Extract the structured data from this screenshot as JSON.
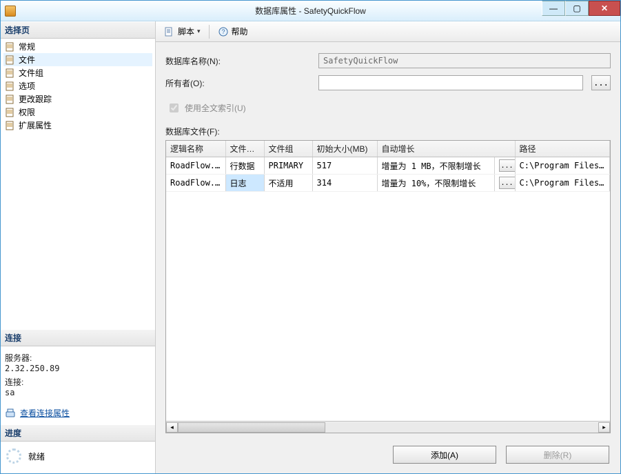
{
  "window": {
    "title": "数据库属性 - SafetyQuickFlow"
  },
  "sidebar": {
    "select_page_header": "选择页",
    "pages": [
      {
        "label": "常规"
      },
      {
        "label": "文件"
      },
      {
        "label": "文件组"
      },
      {
        "label": "选项"
      },
      {
        "label": "更改跟踪"
      },
      {
        "label": "权限"
      },
      {
        "label": "扩展属性"
      }
    ],
    "connection_header": "连接",
    "server_label": "服务器:",
    "server_value": "2.32.250.89",
    "conn_label": "连接:",
    "conn_value": "sa",
    "view_conn_props": "查看连接属性",
    "progress_header": "进度",
    "progress_status": "就绪"
  },
  "toolbar": {
    "script_label": "脚本",
    "help_label": "帮助"
  },
  "form": {
    "db_name_label": "数据库名称(N):",
    "db_name_value": "SafetyQuickFlow",
    "owner_label": "所有者(O):",
    "owner_value": "",
    "browse_label": "...",
    "fulltext_label": "使用全文索引(U)"
  },
  "files_section": {
    "label": "数据库文件(F):",
    "columns": {
      "logical_name": "逻辑名称",
      "file_type": "文件类型",
      "filegroup": "文件组",
      "init_size": "初始大小(MB)",
      "autogrow": "自动增长",
      "path": "路径"
    },
    "rows": [
      {
        "logical_name": "RoadFlow...",
        "file_type": "行数据",
        "filegroup": "PRIMARY",
        "init_size": "517",
        "autogrow": "增量为 1 MB，不限制增长",
        "path": "C:\\Program Files\\Micr"
      },
      {
        "logical_name": "RoadFlow...",
        "file_type": "日志",
        "filegroup": "不适用",
        "init_size": "314",
        "autogrow": "增量为 10%，不限制增长",
        "path": "C:\\Program Files\\Micr"
      }
    ],
    "ellipsis": "..."
  },
  "buttons": {
    "add": "添加(A)",
    "remove": "删除(R)"
  }
}
